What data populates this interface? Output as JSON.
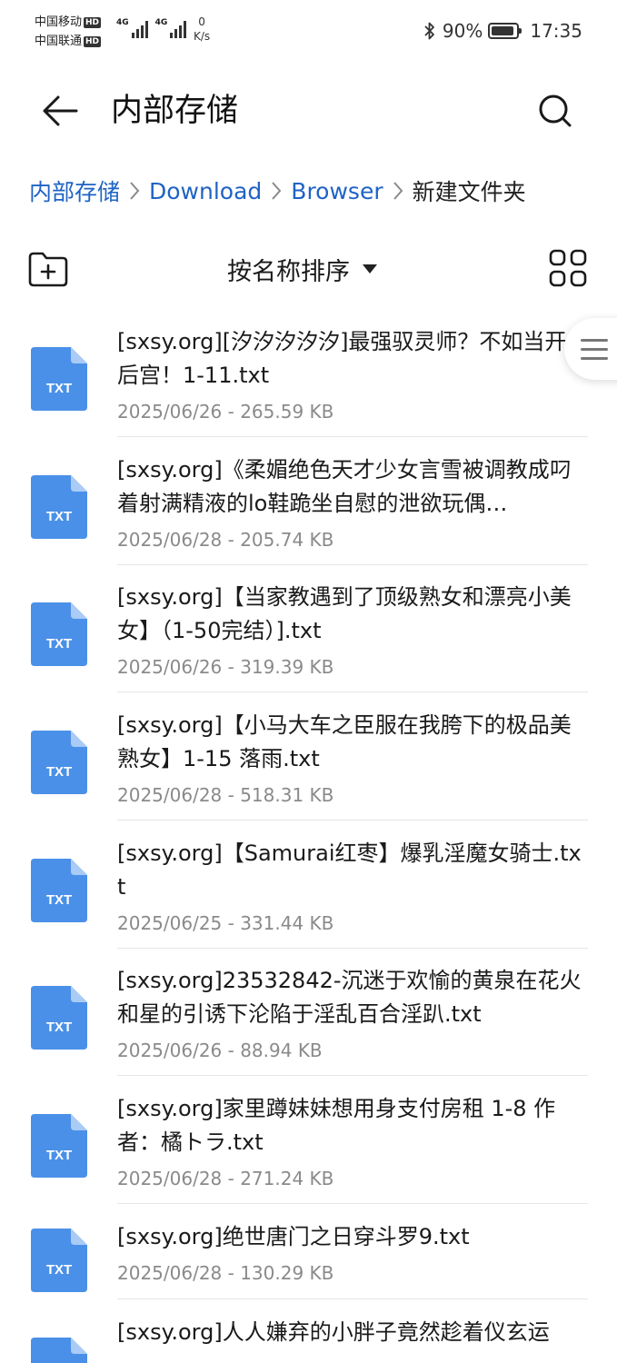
{
  "status_bar": {
    "carrier_1": "中国移动",
    "carrier_2": "中国联通",
    "hd_label": "HD",
    "signal_1_label": "4G",
    "signal_2_label": "4G",
    "net_speed_value": "0",
    "net_speed_unit": "K/s",
    "battery_percent": "90%",
    "battery_level": 0.9,
    "time": "17:35"
  },
  "app_bar": {
    "title": "内部存储"
  },
  "breadcrumb": {
    "items": [
      "内部存储",
      "Download",
      "Browser",
      "新建文件夹"
    ]
  },
  "toolbar": {
    "sort_label": "按名称排序"
  },
  "files": [
    {
      "name": "[sxsy.org][汐汐汐汐汐]最强驭灵师？不如当开后宫！1-11.txt",
      "meta": "2025/06/26 - 265.59 KB",
      "type": "TXT"
    },
    {
      "name": "[sxsy.org]《柔媚绝色天才少女言雪被调教成叼着射满精液的lo鞋跪坐自慰的泄欲玩偶…",
      "meta": "2025/06/28 - 205.74 KB",
      "type": "TXT"
    },
    {
      "name": "[sxsy.org]【当家教遇到了顶级熟女和漂亮小美女】（1-50完结）].txt",
      "meta": "2025/06/26 - 319.39 KB",
      "type": "TXT"
    },
    {
      "name": "[sxsy.org]【小马大车之臣服在我胯下的极品美熟女】1-15 落雨.txt",
      "meta": "2025/06/28 - 518.31 KB",
      "type": "TXT"
    },
    {
      "name": "[sxsy.org]【Samurai红枣】爆乳淫魔女骑士.txt",
      "meta": "2025/06/25 - 331.44 KB",
      "type": "TXT"
    },
    {
      "name": "[sxsy.org]23532842-沉迷于欢愉的黄泉在花火和星的引诱下沦陷于淫乱百合淫趴.txt",
      "meta": "2025/06/26 - 88.94 KB",
      "type": "TXT"
    },
    {
      "name": "[sxsy.org]家里蹲妹妹想用身支付房租 1-8 作者：橘トラ.txt",
      "meta": "2025/06/28 - 271.24 KB",
      "type": "TXT"
    },
    {
      "name": "[sxsy.org]绝世唐门之日穿斗罗9.txt",
      "meta": "2025/06/28 - 130.29 KB",
      "type": "TXT"
    },
    {
      "name": "[sxsy.org]人人嫌弃的小胖子竟然趁着仪玄运",
      "meta": "",
      "type": "TXT"
    }
  ],
  "colors": {
    "accent": "#1f63c4",
    "icon_blue": "#4a90e8",
    "icon_fold": "#a9cbf5"
  },
  "icons": {
    "back": "arrow-left-icon",
    "search": "search-icon",
    "new_folder": "folder-add-icon",
    "grid": "grid-view-icon",
    "file": "txt-file-icon",
    "side_handle": "menu-lines-icon"
  }
}
